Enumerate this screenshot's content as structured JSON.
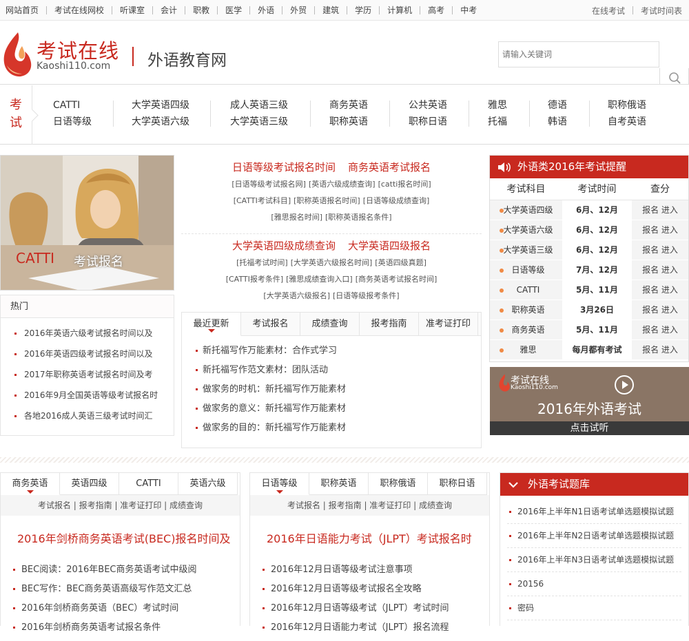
{
  "topnav": {
    "items": [
      "网站首页",
      "考试在线网校",
      "听课室",
      "会计",
      "职教",
      "医学",
      "外语",
      "外贸",
      "建筑",
      "学历",
      "计算机",
      "高考",
      "中考"
    ],
    "right_links": [
      "在线考试",
      "考试时间表"
    ]
  },
  "header": {
    "logo_title": "考试在线",
    "logo_url": "Kaoshi110.com",
    "site_name": "外语教育网",
    "search_placeholder": "请输入关键词"
  },
  "exam_nav": {
    "label": "考试",
    "columns": [
      [
        "CATTI",
        "日语等级"
      ],
      [
        "大学英语四级",
        "大学英语六级"
      ],
      [
        "成人英语三级",
        "大学英语三级"
      ],
      [
        "商务英语",
        "职称英语"
      ],
      [
        "公共英语",
        "职称日语"
      ],
      [
        "雅思",
        "托福"
      ],
      [
        "德语",
        "韩语"
      ],
      [
        "职称俄语",
        "自考英语"
      ]
    ]
  },
  "banner": {
    "word1": "CATTI",
    "word2": "考试报名"
  },
  "hot": {
    "title": "热门",
    "items": [
      "2016年英语六级考试报名时间以及",
      "2016年英语四级考试报名时间以及",
      "2017年职称英语考试报名时间及考",
      "2016年9月全国英语等级考试报名时",
      "各地2016成人英语三级考试时间汇"
    ]
  },
  "center": {
    "headline1": [
      "日语等级考试报名时间",
      "商务英语考试报名"
    ],
    "links1": [
      [
        "[日语等级考试报名网]",
        "[英语六级成绩查询]",
        "[catti报名时间]"
      ],
      [
        "[CATTI考试科目]",
        "[职称英语报名时间]",
        "[日语等级成绩查询]"
      ],
      [
        "[雅思报名时间]",
        "[职称英语报名条件]"
      ]
    ],
    "headline2": [
      "大学英语四级成绩查询",
      "大学英语四级报名"
    ],
    "links2": [
      [
        "[托福考试时间]",
        "[大学英语六级报名时间]",
        "[英语四级真题]"
      ],
      [
        "[CATTI报考条件]",
        "[雅思成绩查询入口]",
        "[商务英语考试报名时间]"
      ],
      [
        "[大学英语六级报名]",
        "[日语等级报考条件]"
      ]
    ],
    "tabs": [
      "最近更新",
      "考试报名",
      "成绩查询",
      "报考指南",
      "准考证打印"
    ],
    "list": [
      "新托福写作万能素材：合作式学习",
      "新托福写作范文素材：团队活动",
      "做家务的时机：新托福写作万能素材",
      "做家务的意义：新托福写作万能素材",
      "做家务的目的：新托福写作万能素材"
    ]
  },
  "reminder": {
    "title": "外语类2016年考试提醒",
    "headers": [
      "考试科目",
      "考试时间",
      "查分"
    ],
    "rows": [
      {
        "subject": "大学英语四级",
        "time": "6月、12月",
        "action": "报名 进入"
      },
      {
        "subject": "大学英语六级",
        "time": "6月、12月",
        "action": "报名 进入"
      },
      {
        "subject": "大学英语三级",
        "time": "6月、12月",
        "action": "报名 进入"
      },
      {
        "subject": "日语等级",
        "time": "7月、12月",
        "action": "报名 进入"
      },
      {
        "subject": "CATTI",
        "time": "5月、11月",
        "action": "报名 进入"
      },
      {
        "subject": "职称英语",
        "time": "3月26日",
        "action": "报名 进入"
      },
      {
        "subject": "商务英语",
        "time": "5月、11月",
        "action": "报名 进入"
      },
      {
        "subject": "雅思",
        "time": "每月都有考试",
        "action": "报名 进入"
      }
    ]
  },
  "video": {
    "logo": "考试在线",
    "logo_url": "Kaoshi110.com",
    "title": "2016年外语考试",
    "button": "点击试听"
  },
  "bottom_left": {
    "tabs": [
      "商务英语",
      "英语四级",
      "CATTI",
      "英语六级"
    ],
    "sublinks": "考试报名 | 报考指南 | 准考证打印 | 成绩查询",
    "headline": "2016年剑桥商务英语考试(BEC)报名时间及",
    "items": [
      "BEC阅读：2016年BEC商务英语考试中级阅",
      "BEC写作：BEC商务英语高级写作范文汇总",
      "2016年剑桥商务英语（BEC）考试时间",
      "2016年剑桥商务英语考试报名条件"
    ]
  },
  "bottom_mid": {
    "tabs": [
      "日语等级",
      "职称英语",
      "职称俄语",
      "职称日语"
    ],
    "sublinks": "考试报名 | 报考指南 | 准考证打印 | 成绩查询",
    "headline": "2016年日语能力考试（JLPT）考试报名时",
    "items": [
      "2016年12月日语等级考试注意事项",
      "2016年12月日语等级考试报名全攻略",
      "2016年12月日语等级考试（JLPT）考试时间",
      "2016年12月日语能力考试（JLPT）报名流程"
    ]
  },
  "bank": {
    "title": "外语考试题库",
    "items": [
      "2016年上半年N1日语考试单选题模拟试题",
      "2016年上半年N2日语考试单选题模拟试题",
      "2016年上半年N3日语考试单选题模拟试题",
      "20156",
      "密码"
    ]
  },
  "colors": {
    "accent": "#c8291f",
    "dot": "#f08a45"
  },
  "icons": [
    "flame-logo-icon",
    "search-icon",
    "speaker-icon",
    "play-icon",
    "chevron-down-icon"
  ]
}
